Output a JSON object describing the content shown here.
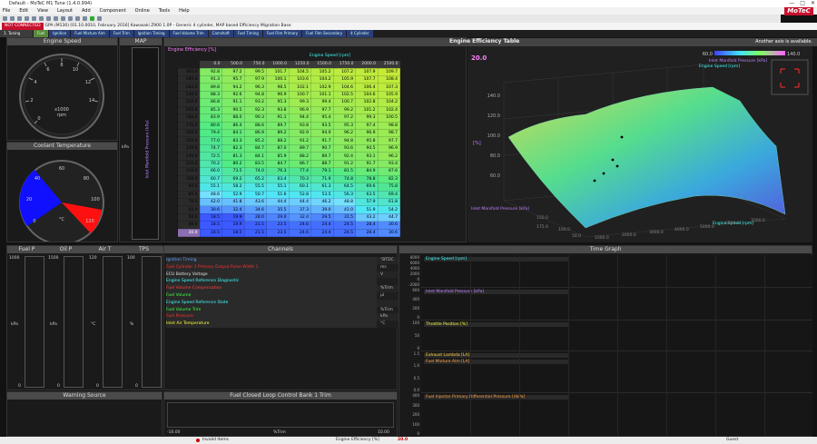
{
  "window": {
    "title": "Default - MoTeC M1 Tune (1.4.0.994)",
    "controls": [
      "—",
      "□",
      "✕"
    ]
  },
  "menu": [
    "File",
    "Edit",
    "View",
    "Layout",
    "Add",
    "Component",
    "Online",
    "Tools",
    "Help"
  ],
  "logo": "MoTeC",
  "info": {
    "status": "NOT CONNECTED",
    "package": "GPA (M130) [01.10.0010, February 2016] Kawasaki Z900 1.0P - Generic 4 cylinder, MAP based Efficiency Migration Base"
  },
  "tabs": [
    "1. Tuning",
    "Fuel",
    "Ignition",
    "Fuel Mixture Aim",
    "Fuel Trim",
    "Ignition Timing",
    "Fuel Volume Trim",
    "Camshaft",
    "Fuel Timing",
    "Fuel Film Primary",
    "Fuel Film Secondary",
    "4 Cylinder"
  ],
  "panels": {
    "engine_speed": "Engine Speed",
    "map": "MAP",
    "coolant": "Coolant Temperature",
    "fuel_p": "Fuel P",
    "oil_p": "Oil P",
    "air_t": "Air T",
    "tps": "TPS",
    "channels": "Channels",
    "time_graph": "Time Graph",
    "warning": "Warning Source",
    "closed_loop": "Fuel Closed Loop Control Bank 1 Trim"
  },
  "gauges": {
    "es_ticks": [
      "0",
      "2",
      "4",
      "6",
      "8",
      "10",
      "12",
      "14"
    ],
    "es_unit": "x1000",
    "es_unit2": "rpm",
    "map_unit": "kPa",
    "ct_ticks": [
      "0",
      "20",
      "40",
      "60",
      "80",
      "100",
      "120"
    ],
    "ct_unit": "°C"
  },
  "bars": [
    {
      "top": "1000",
      "unit": "kPa",
      "bottom": "0"
    },
    {
      "top": "1500",
      "unit": "kPa",
      "bottom": "0"
    },
    {
      "top": "120",
      "unit": "°C",
      "bottom": "0"
    },
    {
      "top": "100",
      "unit": "%",
      "bottom": "0"
    }
  ],
  "table": {
    "title": "Engine Efficiency [%]",
    "header": "Engine Efficiency Table",
    "note": "Another axis is available.",
    "xlabel": "Engine Speed [rpm]",
    "ylabel": "Inlet Manifold Pressure [kPa]",
    "cols": [
      "0.0",
      "500.0",
      "750.0",
      "1000.0",
      "1250.0",
      "1500.0",
      "1750.0",
      "2000.0",
      "2500.0"
    ],
    "rows": [
      "300.0",
      "280.0",
      "260.0",
      "240.0",
      "220.0",
      "200.0",
      "180.0",
      "170.0",
      "160.0",
      "150.0",
      "140.0",
      "130.0",
      "120.0",
      "110.0",
      "100.0",
      "90.0",
      "80.0",
      "70.0",
      "60.0",
      "50.0",
      "40.0",
      "30.0"
    ],
    "values": [
      [
        "92.8",
        "97.2",
        "99.5",
        "101.7",
        "104.5",
        "105.2",
        "107.2",
        "107.9",
        "109.7"
      ],
      [
        "91.3",
        "95.7",
        "97.9",
        "100.1",
        "103.6",
        "104.2",
        "105.9",
        "107.7",
        "108.4"
      ],
      [
        "89.8",
        "94.2",
        "96.3",
        "98.5",
        "102.1",
        "102.9",
        "104.6",
        "106.4",
        "107.3"
      ],
      [
        "88.3",
        "92.6",
        "94.8",
        "96.9",
        "100.7",
        "101.1",
        "102.5",
        "104.6",
        "105.9"
      ],
      [
        "86.8",
        "91.1",
        "93.2",
        "95.3",
        "99.3",
        "99.4",
        "100.7",
        "102.8",
        "104.2"
      ],
      [
        "85.3",
        "90.5",
        "92.3",
        "93.8",
        "96.9",
        "97.7",
        "99.2",
        "101.2",
        "102.4"
      ],
      [
        "83.9",
        "88.0",
        "90.3",
        "91.1",
        "94.4",
        "95.4",
        "97.2",
        "99.3",
        "100.5"
      ],
      [
        "80.6",
        "86.4",
        "88.6",
        "89.7",
        "93.8",
        "93.5",
        "95.3",
        "97.4",
        "98.8"
      ],
      [
        "79.4",
        "84.1",
        "86.9",
        "89.2",
        "92.9",
        "94.9",
        "96.2",
        "96.9",
        "98.7"
      ],
      [
        "77.0",
        "83.3",
        "85.2",
        "88.2",
        "91.2",
        "91.7",
        "94.8",
        "95.8",
        "97.7"
      ],
      [
        "74.7",
        "82.3",
        "84.7",
        "87.0",
        "89.7",
        "90.7",
        "93.6",
        "94.5",
        "96.9"
      ],
      [
        "72.5",
        "81.3",
        "84.1",
        "85.9",
        "88.2",
        "89.7",
        "92.4",
        "93.1",
        "96.2"
      ],
      [
        "70.2",
        "80.2",
        "83.5",
        "84.7",
        "86.7",
        "88.7",
        "91.2",
        "91.7",
        "93.4"
      ],
      [
        "66.0",
        "73.5",
        "74.0",
        "76.3",
        "77.4",
        "79.1",
        "81.5",
        "84.9",
        "87.6"
      ],
      [
        "60.7",
        "69.2",
        "65.2",
        "63.4",
        "70.3",
        "71.9",
        "74.8",
        "78.8",
        "82.3"
      ],
      [
        "55.1",
        "58.2",
        "55.5",
        "55.1",
        "60.1",
        "61.3",
        "64.5",
        "69.6",
        "75.8"
      ],
      [
        "48.6",
        "52.9",
        "50.7",
        "51.6",
        "52.8",
        "53.5",
        "56.3",
        "63.5",
        "69.4"
      ],
      [
        "42.0",
        "41.8",
        "43.6",
        "44.4",
        "44.4",
        "46.2",
        "48.8",
        "57.9",
        "61.8"
      ],
      [
        "30.6",
        "32.4",
        "34.6",
        "35.5",
        "37.3",
        "39.0",
        "41.0",
        "51.9",
        "54.2"
      ],
      [
        "18.5",
        "19.9",
        "28.0",
        "29.0",
        "32.4",
        "29.5",
        "31.5",
        "43.2",
        "44.7"
      ],
      [
        "18.5",
        "19.9",
        "21.5",
        "23.5",
        "24.6",
        "24.4",
        "24.5",
        "28.4",
        "30.6"
      ],
      [
        "18.5",
        "18.5",
        "21.5",
        "23.5",
        "24.6",
        "24.4",
        "24.5",
        "28.4",
        "30.6"
      ]
    ]
  },
  "plot3d": {
    "value": "20.0",
    "scale_min": "60.0",
    "scale_max": "140.0",
    "legend1": "Inlet Manifold Pressure [kPa]",
    "legend2": "Engine Speed [rpm]",
    "zlabel": "[%]",
    "zticks": [
      "140.0",
      "120.0",
      "100.0",
      "80.0",
      "60.0"
    ],
    "ylabel": "Inlet Manifold Pressure [kPa]",
    "xlabel": "Engine Speed [rpm]",
    "yticks": [
      "150.0",
      "175.0",
      "100.0",
      "50.0"
    ],
    "xticks": [
      "1000.0",
      "2000.0",
      "3000.0",
      "4000.0",
      "5000.0",
      "6000.0",
      "7000.0"
    ]
  },
  "channels": [
    {
      "name": "Ignition Timing",
      "unit": "°BTDC",
      "color": "#5aa0ff"
    },
    {
      "name": "Fuel Cylinder 1 Primary Output Pulse Width 1",
      "unit": "ms",
      "color": "#ff3030"
    },
    {
      "name": "ECU Battery Voltage",
      "unit": "V",
      "color": "#e0e0e0"
    },
    {
      "name": "Engine Speed Reference Diagnostic",
      "unit": "",
      "color": "#40ffff"
    },
    {
      "name": "Fuel Volume Compensation",
      "unit": "%Trim",
      "color": "#ff4040"
    },
    {
      "name": "Fuel Volume",
      "unit": "µl",
      "color": "#40ff40"
    },
    {
      "name": "Engine Speed Reference State",
      "unit": "",
      "color": "#40ffff"
    },
    {
      "name": "Fuel Volume Trim",
      "unit": "%Trim",
      "color": "#40ff40"
    },
    {
      "name": "Fuel Pressure",
      "unit": "kPa",
      "color": "#ff3030"
    },
    {
      "name": "Inlet Air Temperature",
      "unit": "°C",
      "color": "#ffff40"
    }
  ],
  "timegraph": [
    {
      "labels": [
        "Engine Speed [rpm]"
      ],
      "ticks": [
        "8000",
        "6000",
        "4000",
        "2000",
        "0",
        "-2000"
      ],
      "colors": [
        "#40ffff"
      ]
    },
    {
      "labels": [
        "Inlet Manifold Pressure [kPa]"
      ],
      "ticks": [
        "600",
        "400",
        "200",
        "0"
      ],
      "colors": [
        "#c080ff"
      ]
    },
    {
      "labels": [
        "Throttle Position [%]"
      ],
      "ticks": [
        "100",
        "50",
        "0"
      ],
      "colors": [
        "#ffff40"
      ]
    },
    {
      "labels": [
        "Exhaust Lambda [LA]",
        "Fuel Mixture Aim [LA]"
      ],
      "ticks": [
        "1.5",
        "1.0",
        "0.5",
        "0.0"
      ],
      "colors": [
        "#ffd040",
        "#ffa040"
      ]
    },
    {
      "labels": [
        "Fuel Injector Primary Differential Pressure [dkPa]"
      ],
      "ticks": [
        "400",
        "300",
        "200",
        "100",
        "0"
      ],
      "colors": [
        "#ffa040"
      ]
    }
  ],
  "closed_loop": {
    "min": "-10.00",
    "unit": "%Trim",
    "max": "10.00"
  },
  "statusbar": {
    "invalid": "Invalid Items",
    "efficiency": "Engine Efficiency [%]",
    "value": "20.0",
    "guest": "Guest"
  }
}
